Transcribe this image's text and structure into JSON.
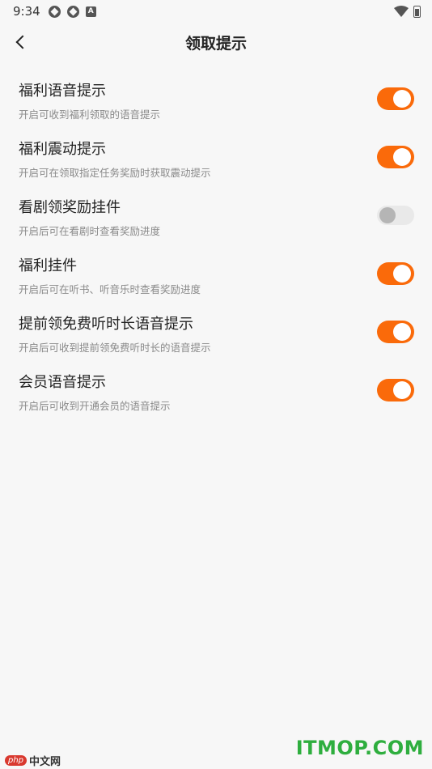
{
  "status_bar": {
    "time": "9:34",
    "left_icons": [
      "app-icon-1",
      "app-icon-2",
      "a-icon"
    ],
    "a_glyph": "A",
    "right_icons": [
      "wifi-icon",
      "battery-icon"
    ]
  },
  "header": {
    "title": "领取提示",
    "back_icon": "chevron-left-icon"
  },
  "settings": [
    {
      "title": "福利语音提示",
      "desc": "开启可收到福利领取的语音提示",
      "enabled": true
    },
    {
      "title": "福利震动提示",
      "desc": "开启可在领取指定任务奖励时获取震动提示",
      "enabled": true
    },
    {
      "title": "看剧领奖励挂件",
      "desc": "开启后可在看剧时查看奖励进度",
      "enabled": false
    },
    {
      "title": "福利挂件",
      "desc": "开启后可在听书、听音乐时查看奖励进度",
      "enabled": true
    },
    {
      "title": "提前领免费听时长语音提示",
      "desc": "开启后可收到提前领免费听时长的语音提示",
      "enabled": true
    },
    {
      "title": "会员语音提示",
      "desc": "开启后可收到开通会员的语音提示",
      "enabled": true
    }
  ],
  "colors": {
    "toggle_on": "#fa6a0a",
    "toggle_off": "#e9e9e9",
    "background": "#f7f7f7"
  },
  "watermarks": {
    "php_badge": "php",
    "php_text": "中文网",
    "itmop": "ITMOP.COM"
  }
}
